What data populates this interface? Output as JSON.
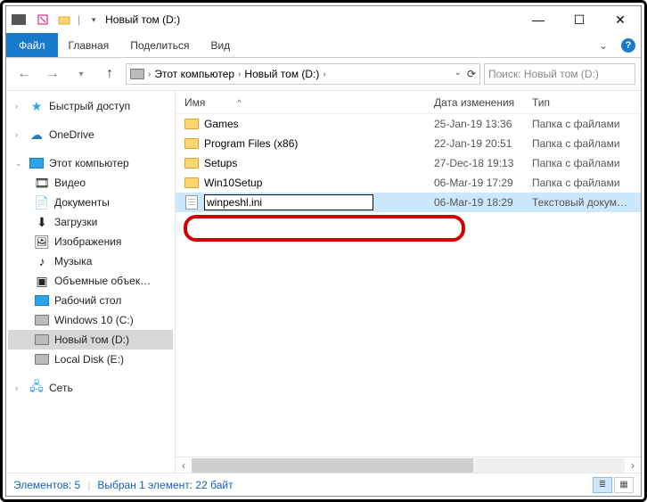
{
  "window": {
    "title": "Новый том (D:)",
    "qat_separator": "|"
  },
  "ribbon": {
    "file": "Файл",
    "tabs": [
      "Главная",
      "Поделиться",
      "Вид"
    ]
  },
  "address": {
    "crumbs": [
      "Этот компьютер",
      "Новый том (D:)"
    ]
  },
  "search": {
    "placeholder": "Поиск: Новый том (D:)"
  },
  "sidebar": {
    "quick": "Быстрый доступ",
    "onedrive": "OneDrive",
    "thispc": "Этот компьютер",
    "thispc_items": [
      "Видео",
      "Документы",
      "Загрузки",
      "Изображения",
      "Музыка",
      "Объемные объек…",
      "Рабочий стол",
      "Windows 10 (C:)",
      "Новый том (D:)",
      "Local Disk (E:)"
    ],
    "network": "Сеть"
  },
  "columns": {
    "name": "Имя",
    "date": "Дата изменения",
    "type": "Тип"
  },
  "rows": [
    {
      "icon": "folder",
      "name": "Games",
      "date": "25-Jan-19 13:36",
      "type": "Папка с файлами"
    },
    {
      "icon": "folder",
      "name": "Program Files (x86)",
      "date": "22-Jan-19 20:51",
      "type": "Папка с файлами"
    },
    {
      "icon": "folder",
      "name": "Setups",
      "date": "27-Dec-18 19:13",
      "type": "Папка с файлами"
    },
    {
      "icon": "folder",
      "name": "Win10Setup",
      "date": "06-Mar-19 17:29",
      "type": "Папка с файлами"
    },
    {
      "icon": "text",
      "name": "winpeshl.ini",
      "date": "06-Mar-19 18:29",
      "type": "Текстовый докум…",
      "selected": true,
      "renaming": true
    }
  ],
  "status": {
    "count_label": "Элементов: 5",
    "selection_label": "Выбран 1 элемент: 22 байт"
  }
}
